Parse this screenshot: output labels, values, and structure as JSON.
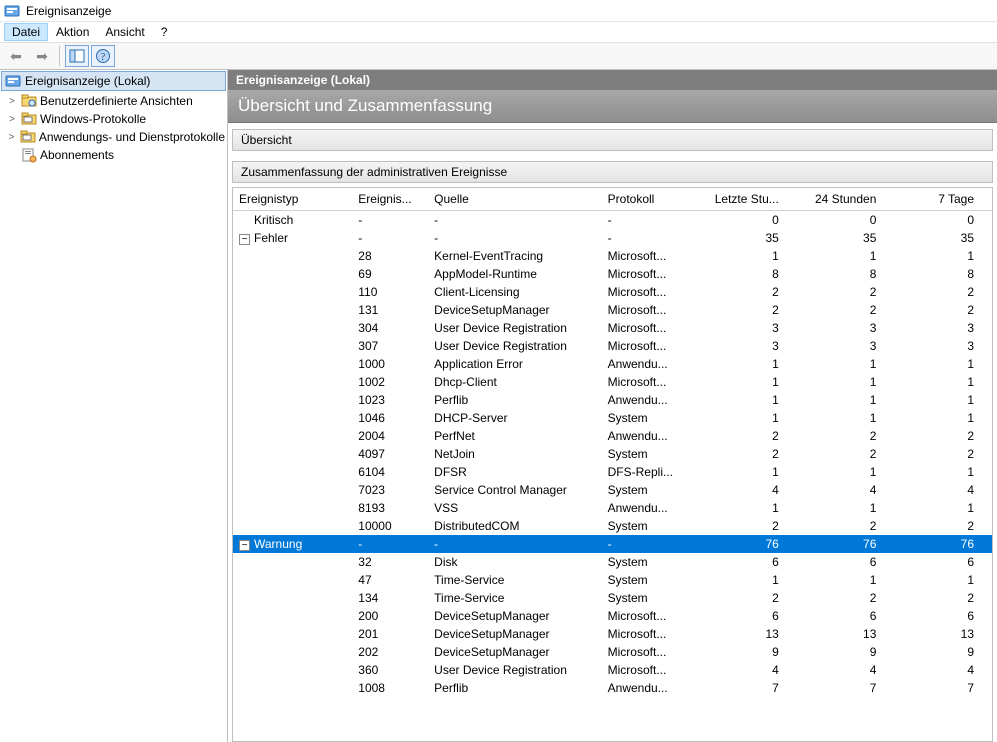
{
  "window": {
    "title": "Ereignisanzeige"
  },
  "menu": {
    "file": "Datei",
    "action": "Aktion",
    "view": "Ansicht",
    "help": "?"
  },
  "nav": {
    "root": "Ereignisanzeige (Lokal)",
    "items": [
      {
        "label": "Benutzerdefinierte Ansichten",
        "twisty": ">"
      },
      {
        "label": "Windows-Protokolle",
        "twisty": ">"
      },
      {
        "label": "Anwendungs- und Dienstprotokolle",
        "twisty": ">"
      },
      {
        "label": "Abonnements",
        "twisty": ""
      }
    ]
  },
  "content": {
    "title": "Ereignisanzeige (Lokal)",
    "subtitle": "Übersicht und Zusammenfassung",
    "section_overview": "Übersicht",
    "section_summary": "Zusammenfassung der administrativen Ereignisse"
  },
  "columns": {
    "type": "Ereignistyp",
    "id": "Ereignis...",
    "source": "Quelle",
    "log": "Protokoll",
    "lasthour": "Letzte Stu...",
    "h24": "24 Stunden",
    "d7": "7 Tage"
  },
  "rows": [
    {
      "kind": "group",
      "expander": "",
      "type": "Kritisch",
      "id": "-",
      "source": "-",
      "log": "-",
      "h1": 0,
      "h24": 0,
      "d7": 0
    },
    {
      "kind": "group",
      "expander": "-",
      "type": "Fehler",
      "id": "-",
      "source": "-",
      "log": "-",
      "h1": 35,
      "h24": 35,
      "d7": 35
    },
    {
      "kind": "row",
      "id": "28",
      "source": "Kernel-EventTracing",
      "log": "Microsoft...",
      "h1": 1,
      "h24": 1,
      "d7": 1
    },
    {
      "kind": "row",
      "id": "69",
      "source": "AppModel-Runtime",
      "log": "Microsoft...",
      "h1": 8,
      "h24": 8,
      "d7": 8
    },
    {
      "kind": "row",
      "id": "110",
      "source": "Client-Licensing",
      "log": "Microsoft...",
      "h1": 2,
      "h24": 2,
      "d7": 2
    },
    {
      "kind": "row",
      "id": "131",
      "source": "DeviceSetupManager",
      "log": "Microsoft...",
      "h1": 2,
      "h24": 2,
      "d7": 2
    },
    {
      "kind": "row",
      "id": "304",
      "source": "User Device Registration",
      "log": "Microsoft...",
      "h1": 3,
      "h24": 3,
      "d7": 3
    },
    {
      "kind": "row",
      "id": "307",
      "source": "User Device Registration",
      "log": "Microsoft...",
      "h1": 3,
      "h24": 3,
      "d7": 3
    },
    {
      "kind": "row",
      "id": "1000",
      "source": "Application Error",
      "log": "Anwendu...",
      "h1": 1,
      "h24": 1,
      "d7": 1
    },
    {
      "kind": "row",
      "id": "1002",
      "source": "Dhcp-Client",
      "log": "Microsoft...",
      "h1": 1,
      "h24": 1,
      "d7": 1
    },
    {
      "kind": "row",
      "id": "1023",
      "source": "Perflib",
      "log": "Anwendu...",
      "h1": 1,
      "h24": 1,
      "d7": 1
    },
    {
      "kind": "row",
      "id": "1046",
      "source": "DHCP-Server",
      "log": "System",
      "h1": 1,
      "h24": 1,
      "d7": 1
    },
    {
      "kind": "row",
      "id": "2004",
      "source": "PerfNet",
      "log": "Anwendu...",
      "h1": 2,
      "h24": 2,
      "d7": 2
    },
    {
      "kind": "row",
      "id": "4097",
      "source": "NetJoin",
      "log": "System",
      "h1": 2,
      "h24": 2,
      "d7": 2
    },
    {
      "kind": "row",
      "id": "6104",
      "source": "DFSR",
      "log": "DFS-Repli...",
      "h1": 1,
      "h24": 1,
      "d7": 1
    },
    {
      "kind": "row",
      "id": "7023",
      "source": "Service Control Manager",
      "log": "System",
      "h1": 4,
      "h24": 4,
      "d7": 4
    },
    {
      "kind": "row",
      "id": "8193",
      "source": "VSS",
      "log": "Anwendu...",
      "h1": 1,
      "h24": 1,
      "d7": 1
    },
    {
      "kind": "row",
      "id": "10000",
      "source": "DistributedCOM",
      "log": "System",
      "h1": 2,
      "h24": 2,
      "d7": 2
    },
    {
      "kind": "group",
      "selected": true,
      "expander": "-",
      "type": "Warnung",
      "id": "-",
      "source": "-",
      "log": "-",
      "h1": 76,
      "h24": 76,
      "d7": 76
    },
    {
      "kind": "row",
      "id": "32",
      "source": "Disk",
      "log": "System",
      "h1": 6,
      "h24": 6,
      "d7": 6
    },
    {
      "kind": "row",
      "id": "47",
      "source": "Time-Service",
      "log": "System",
      "h1": 1,
      "h24": 1,
      "d7": 1
    },
    {
      "kind": "row",
      "id": "134",
      "source": "Time-Service",
      "log": "System",
      "h1": 2,
      "h24": 2,
      "d7": 2
    },
    {
      "kind": "row",
      "id": "200",
      "source": "DeviceSetupManager",
      "log": "Microsoft...",
      "h1": 6,
      "h24": 6,
      "d7": 6
    },
    {
      "kind": "row",
      "id": "201",
      "source": "DeviceSetupManager",
      "log": "Microsoft...",
      "h1": 13,
      "h24": 13,
      "d7": 13
    },
    {
      "kind": "row",
      "id": "202",
      "source": "DeviceSetupManager",
      "log": "Microsoft...",
      "h1": 9,
      "h24": 9,
      "d7": 9
    },
    {
      "kind": "row",
      "id": "360",
      "source": "User Device Registration",
      "log": "Microsoft...",
      "h1": 4,
      "h24": 4,
      "d7": 4
    },
    {
      "kind": "row",
      "id": "1008",
      "source": "Perflib",
      "log": "Anwendu...",
      "h1": 7,
      "h24": 7,
      "d7": 7
    }
  ]
}
